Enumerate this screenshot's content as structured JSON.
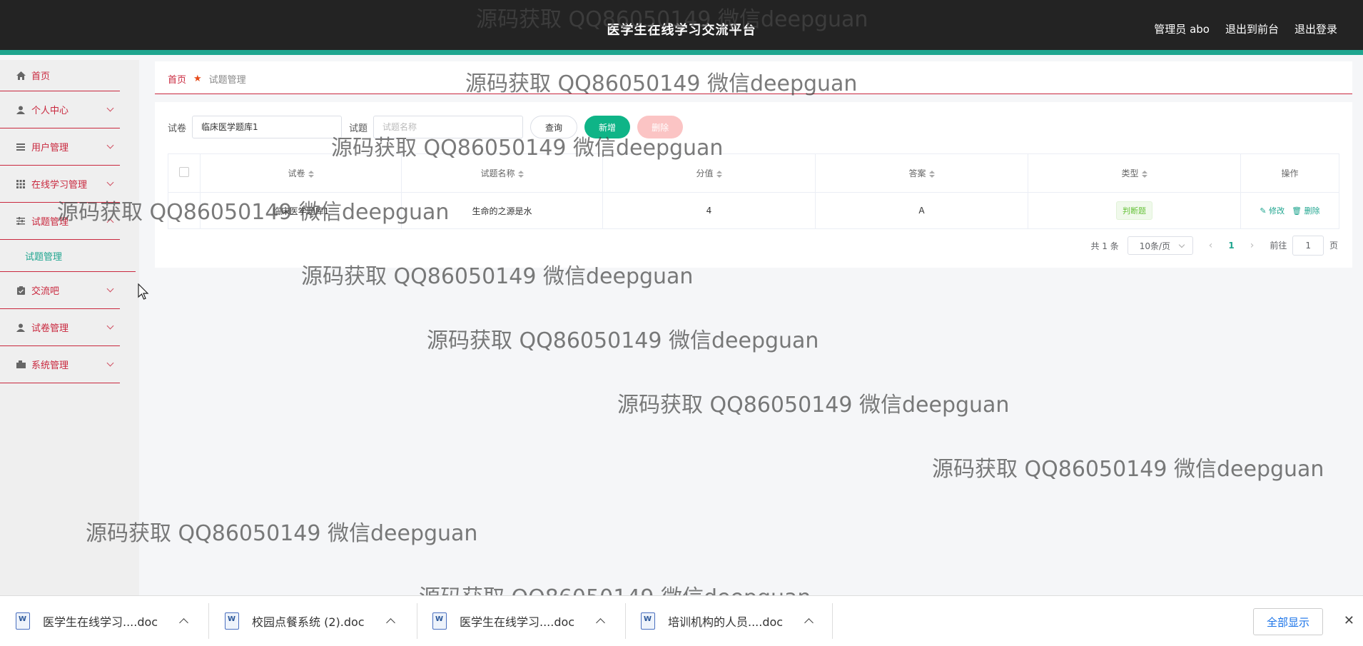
{
  "header": {
    "title": "医学生在线学习交流平台",
    "admin": "管理员 abo",
    "back_front": "退出到前台",
    "logout": "退出登录"
  },
  "sidebar": {
    "items": [
      {
        "label": "首页",
        "icon": "home-icon"
      },
      {
        "label": "个人中心",
        "icon": "user-icon"
      },
      {
        "label": "用户管理",
        "icon": "list-icon"
      },
      {
        "label": "在线学习管理",
        "icon": "grid-icon"
      },
      {
        "label": "试题管理",
        "icon": "sliders-icon"
      },
      {
        "label": "交流吧",
        "icon": "clipboard-icon"
      },
      {
        "label": "试卷管理",
        "icon": "user-icon"
      },
      {
        "label": "系统管理",
        "icon": "system-icon"
      }
    ],
    "submenu": {
      "label": "试题管理"
    }
  },
  "breadcrumb": {
    "home": "首页",
    "current": "试题管理"
  },
  "search": {
    "paper_label": "试卷",
    "paper_value": "临床医学题库1",
    "question_label": "试题",
    "question_placeholder": "试题名称",
    "query_btn": "查询",
    "add_btn": "新增",
    "delete_btn": "删除"
  },
  "table": {
    "headers": [
      "试卷",
      "试题名称",
      "分值",
      "答案",
      "类型",
      "操作"
    ],
    "rows": [
      {
        "paper": "临床医学题库1",
        "name": "生命的之源是水",
        "score": "4",
        "answer": "A",
        "type": "判断题",
        "edit": "修改",
        "delete": "删除"
      }
    ]
  },
  "pagination": {
    "total": "共 1 条",
    "page_size": "10条/页",
    "current": "1",
    "goto_prefix": "前往",
    "goto_value": "1",
    "goto_suffix": "页"
  },
  "watermark": "源码获取 QQ86050149 微信deepguan",
  "downloads": {
    "items": [
      "医学生在线学习....doc",
      "校园点餐系统 (2).doc",
      "医学生在线学习....doc",
      "培训机构的人员....doc"
    ],
    "show_all": "全部显示"
  },
  "colors": {
    "accent": "#1fa58f",
    "menu_red": "#c9283e",
    "header_bg": "#232323",
    "add_green": "#0fb487"
  }
}
